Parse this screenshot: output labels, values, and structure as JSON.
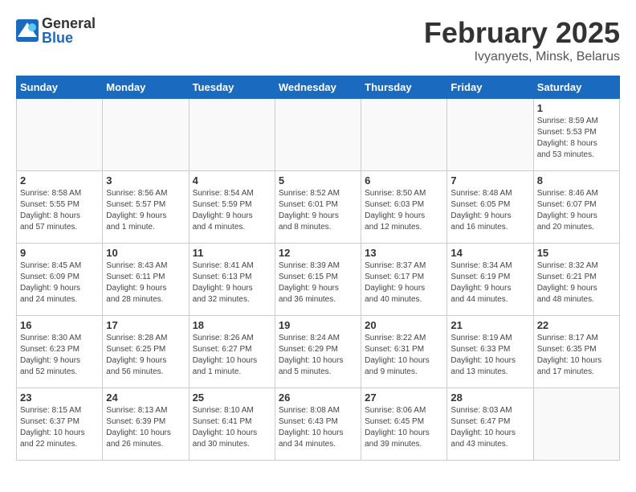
{
  "logo": {
    "general": "General",
    "blue": "Blue"
  },
  "header": {
    "title": "February 2025",
    "subtitle": "Ivyanyets, Minsk, Belarus"
  },
  "weekdays": [
    "Sunday",
    "Monday",
    "Tuesday",
    "Wednesday",
    "Thursday",
    "Friday",
    "Saturday"
  ],
  "weeks": [
    [
      {
        "day": "",
        "info": ""
      },
      {
        "day": "",
        "info": ""
      },
      {
        "day": "",
        "info": ""
      },
      {
        "day": "",
        "info": ""
      },
      {
        "day": "",
        "info": ""
      },
      {
        "day": "",
        "info": ""
      },
      {
        "day": "1",
        "info": "Sunrise: 8:59 AM\nSunset: 5:53 PM\nDaylight: 8 hours\nand 53 minutes."
      }
    ],
    [
      {
        "day": "2",
        "info": "Sunrise: 8:58 AM\nSunset: 5:55 PM\nDaylight: 8 hours\nand 57 minutes."
      },
      {
        "day": "3",
        "info": "Sunrise: 8:56 AM\nSunset: 5:57 PM\nDaylight: 9 hours\nand 1 minute."
      },
      {
        "day": "4",
        "info": "Sunrise: 8:54 AM\nSunset: 5:59 PM\nDaylight: 9 hours\nand 4 minutes."
      },
      {
        "day": "5",
        "info": "Sunrise: 8:52 AM\nSunset: 6:01 PM\nDaylight: 9 hours\nand 8 minutes."
      },
      {
        "day": "6",
        "info": "Sunrise: 8:50 AM\nSunset: 6:03 PM\nDaylight: 9 hours\nand 12 minutes."
      },
      {
        "day": "7",
        "info": "Sunrise: 8:48 AM\nSunset: 6:05 PM\nDaylight: 9 hours\nand 16 minutes."
      },
      {
        "day": "8",
        "info": "Sunrise: 8:46 AM\nSunset: 6:07 PM\nDaylight: 9 hours\nand 20 minutes."
      }
    ],
    [
      {
        "day": "9",
        "info": "Sunrise: 8:45 AM\nSunset: 6:09 PM\nDaylight: 9 hours\nand 24 minutes."
      },
      {
        "day": "10",
        "info": "Sunrise: 8:43 AM\nSunset: 6:11 PM\nDaylight: 9 hours\nand 28 minutes."
      },
      {
        "day": "11",
        "info": "Sunrise: 8:41 AM\nSunset: 6:13 PM\nDaylight: 9 hours\nand 32 minutes."
      },
      {
        "day": "12",
        "info": "Sunrise: 8:39 AM\nSunset: 6:15 PM\nDaylight: 9 hours\nand 36 minutes."
      },
      {
        "day": "13",
        "info": "Sunrise: 8:37 AM\nSunset: 6:17 PM\nDaylight: 9 hours\nand 40 minutes."
      },
      {
        "day": "14",
        "info": "Sunrise: 8:34 AM\nSunset: 6:19 PM\nDaylight: 9 hours\nand 44 minutes."
      },
      {
        "day": "15",
        "info": "Sunrise: 8:32 AM\nSunset: 6:21 PM\nDaylight: 9 hours\nand 48 minutes."
      }
    ],
    [
      {
        "day": "16",
        "info": "Sunrise: 8:30 AM\nSunset: 6:23 PM\nDaylight: 9 hours\nand 52 minutes."
      },
      {
        "day": "17",
        "info": "Sunrise: 8:28 AM\nSunset: 6:25 PM\nDaylight: 9 hours\nand 56 minutes."
      },
      {
        "day": "18",
        "info": "Sunrise: 8:26 AM\nSunset: 6:27 PM\nDaylight: 10 hours\nand 1 minute."
      },
      {
        "day": "19",
        "info": "Sunrise: 8:24 AM\nSunset: 6:29 PM\nDaylight: 10 hours\nand 5 minutes."
      },
      {
        "day": "20",
        "info": "Sunrise: 8:22 AM\nSunset: 6:31 PM\nDaylight: 10 hours\nand 9 minutes."
      },
      {
        "day": "21",
        "info": "Sunrise: 8:19 AM\nSunset: 6:33 PM\nDaylight: 10 hours\nand 13 minutes."
      },
      {
        "day": "22",
        "info": "Sunrise: 8:17 AM\nSunset: 6:35 PM\nDaylight: 10 hours\nand 17 minutes."
      }
    ],
    [
      {
        "day": "23",
        "info": "Sunrise: 8:15 AM\nSunset: 6:37 PM\nDaylight: 10 hours\nand 22 minutes."
      },
      {
        "day": "24",
        "info": "Sunrise: 8:13 AM\nSunset: 6:39 PM\nDaylight: 10 hours\nand 26 minutes."
      },
      {
        "day": "25",
        "info": "Sunrise: 8:10 AM\nSunset: 6:41 PM\nDaylight: 10 hours\nand 30 minutes."
      },
      {
        "day": "26",
        "info": "Sunrise: 8:08 AM\nSunset: 6:43 PM\nDaylight: 10 hours\nand 34 minutes."
      },
      {
        "day": "27",
        "info": "Sunrise: 8:06 AM\nSunset: 6:45 PM\nDaylight: 10 hours\nand 39 minutes."
      },
      {
        "day": "28",
        "info": "Sunrise: 8:03 AM\nSunset: 6:47 PM\nDaylight: 10 hours\nand 43 minutes."
      },
      {
        "day": "",
        "info": ""
      }
    ]
  ]
}
